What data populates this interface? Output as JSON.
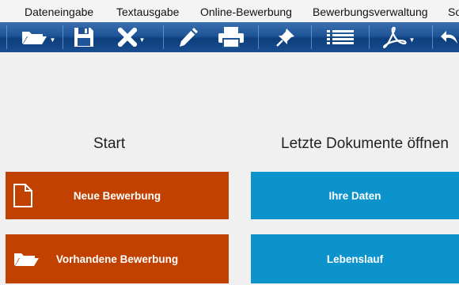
{
  "menu": {
    "items": [
      "Dateneingabe",
      "Textausgabe",
      "Online-Bewerbung",
      "Bewerbungsverwaltung",
      "So"
    ]
  },
  "toolbar": {
    "buttons": [
      "open-folder-icon",
      "save-disk-icon",
      "delete-x-icon",
      "edit-pencil-icon",
      "print-icon",
      "pin-icon",
      "list-icon",
      "pdf-icon",
      "back-arrow-icon"
    ],
    "color": "#1f5597"
  },
  "start": {
    "heading": "Start",
    "new_application": "Neue Bewerbung",
    "existing_application": "Vorhandene Bewerbung",
    "color": "#c14200"
  },
  "recent": {
    "heading": "Letzte Dokumente öffnen",
    "your_data": "Ihre Daten",
    "cv": "Lebenslauf",
    "color": "#0c93cc"
  }
}
